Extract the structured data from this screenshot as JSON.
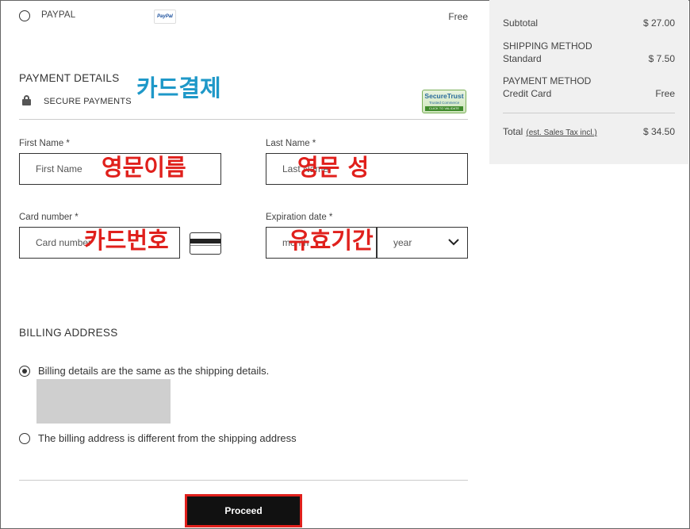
{
  "paypal": {
    "label": "PAYPAL",
    "logo_text": "PayPal",
    "price": "Free"
  },
  "payment_details": {
    "title": "PAYMENT DETAILS",
    "secure_label": "SECURE PAYMENTS",
    "badge": {
      "line1": "SecureTrust",
      "line2": "Trusted Commerce",
      "line3": "CLICK TO VALIDATE"
    }
  },
  "annotations": {
    "card_payment": "카드결제",
    "english_name": "영문이름",
    "english_surname": "영문 성",
    "card_number": "카드번호",
    "expiration": "유효기간"
  },
  "fields": {
    "first_name": {
      "label": "First Name *",
      "placeholder": "First Name"
    },
    "last_name": {
      "label": "Last Name *",
      "placeholder": "Last Name"
    },
    "card_number": {
      "label": "Card number *",
      "placeholder": "Card number"
    },
    "expiration": {
      "label": "Expiration date *",
      "month_placeholder": "month",
      "year_placeholder": "year"
    }
  },
  "billing": {
    "title": "BILLING ADDRESS",
    "option_same": "Billing details are the same as the shipping details.",
    "option_different": "The billing address is different from the shipping address",
    "selected": "same"
  },
  "proceed_label": "Proceed",
  "summary": {
    "subtotal_label": "Subtotal",
    "subtotal_value": "$ 27.00",
    "shipping_caption": "SHIPPING METHOD",
    "shipping_method": "Standard",
    "shipping_value": "$ 7.50",
    "payment_caption": "PAYMENT METHOD",
    "payment_method": "Credit Card",
    "payment_value": "Free",
    "total_label": "Total",
    "total_note": "(est. Sales Tax incl.)",
    "total_value": "$ 34.50"
  },
  "colors": {
    "annotation_blue": "#1e98c8",
    "annotation_red": "#e0201c",
    "button": "#111111"
  }
}
